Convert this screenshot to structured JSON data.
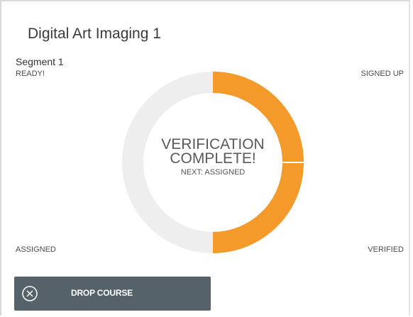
{
  "course": {
    "title": "Digital Art Imaging 1",
    "segment": "Segment 1"
  },
  "progress": {
    "stages": {
      "ready": "READY!",
      "signed_up": "SIGNED UP",
      "assigned": "ASSIGNED",
      "verified": "VERIFIED"
    },
    "completed_fraction": 0.5,
    "status_line1": "VERIFICATION",
    "status_line2": "COMPLETE!",
    "next": "NEXT: ASSIGNED"
  },
  "actions": {
    "drop_label": "DROP COURSE",
    "drop_icon": "circle-x-icon"
  },
  "colors": {
    "complete": "#f49a2a",
    "pending": "#eeeeee",
    "button_bg": "#55626a"
  }
}
